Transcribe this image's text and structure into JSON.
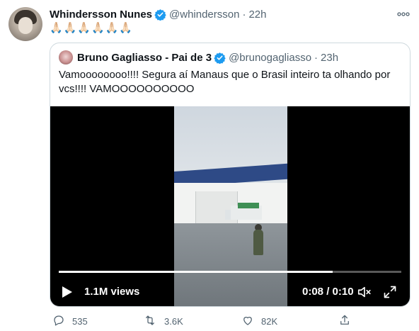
{
  "tweet": {
    "author_name": "Whindersson Nunes",
    "handle": "@whindersson",
    "separator": "·",
    "time": "22h",
    "more_label": "ooo",
    "emoji_text": "🙏🏻🙏🏻🙏🏻🙏🏻🙏🏻🙏🏻"
  },
  "quoted": {
    "author_name": "Bruno Gagliasso - Pai de 3",
    "handle": "@brunogagliasso",
    "separator": "·",
    "time": "23h",
    "text": "Vamoooooooo!!!! Segura aí Manaus que o Brasil inteiro ta olhando por vcs!!!! VAMOOOOOOOOOO",
    "video": {
      "views": "1.1M views",
      "time": "0:08 / 0:10",
      "progress": 0.8
    }
  },
  "actions": {
    "replies": "535",
    "retweets": "3.6K",
    "likes": "82K"
  },
  "colors": {
    "verified": "#1d9bf0",
    "muted_text": "#536471",
    "border": "#cfd9de"
  },
  "icons": [
    "verified-icon",
    "more-icon",
    "play-icon",
    "mute-icon",
    "expand-icon",
    "reply-icon",
    "retweet-icon",
    "like-icon",
    "share-icon"
  ]
}
